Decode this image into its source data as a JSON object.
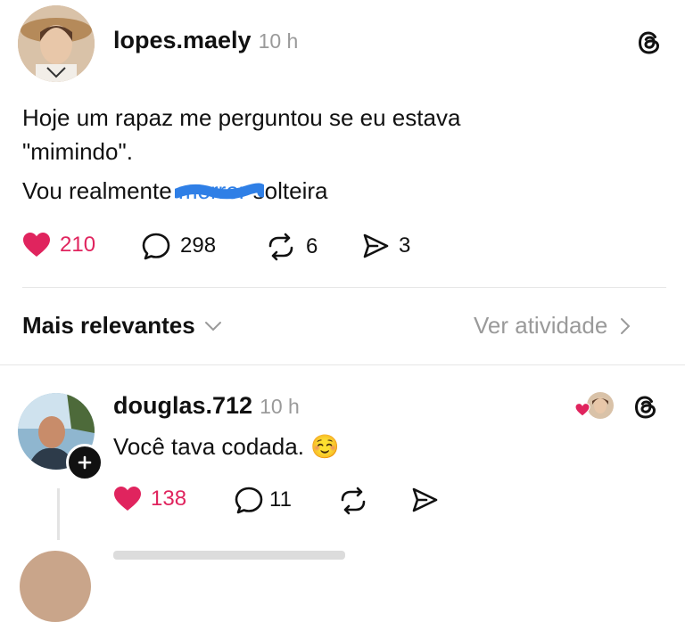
{
  "post": {
    "username": "lopes.maely",
    "time": "10 h",
    "line1": "Hoje um rapaz me perguntou se eu estava",
    "line2": "\"mimindo\".",
    "line3_before": "Vou realmente ",
    "line3_struck": "morrer",
    "line3_after": " solteira",
    "likes": "210",
    "replies": "298",
    "reposts": "6",
    "shares": "3",
    "liked": true
  },
  "sort": {
    "label": "Mais relevantes",
    "activity_link": "Ver atividade"
  },
  "reply": {
    "username": "douglas.712",
    "time": "10 h",
    "text": "Você tava codada. ☺️",
    "likes": "138",
    "replies": "11",
    "liked": true
  },
  "icons": {
    "threads": "threads-logo-icon",
    "heart": "heart-icon",
    "reply": "comment-bubble-icon",
    "repost": "repost-icon",
    "share": "send-icon",
    "chevron_down": "chevron-down-icon",
    "chevron_right": "chevron-right-icon",
    "follow_plus": "plus-icon"
  },
  "colors": {
    "like": "#e0245e",
    "muted": "#9a9a9a",
    "scribble": "#2f7fe6"
  }
}
